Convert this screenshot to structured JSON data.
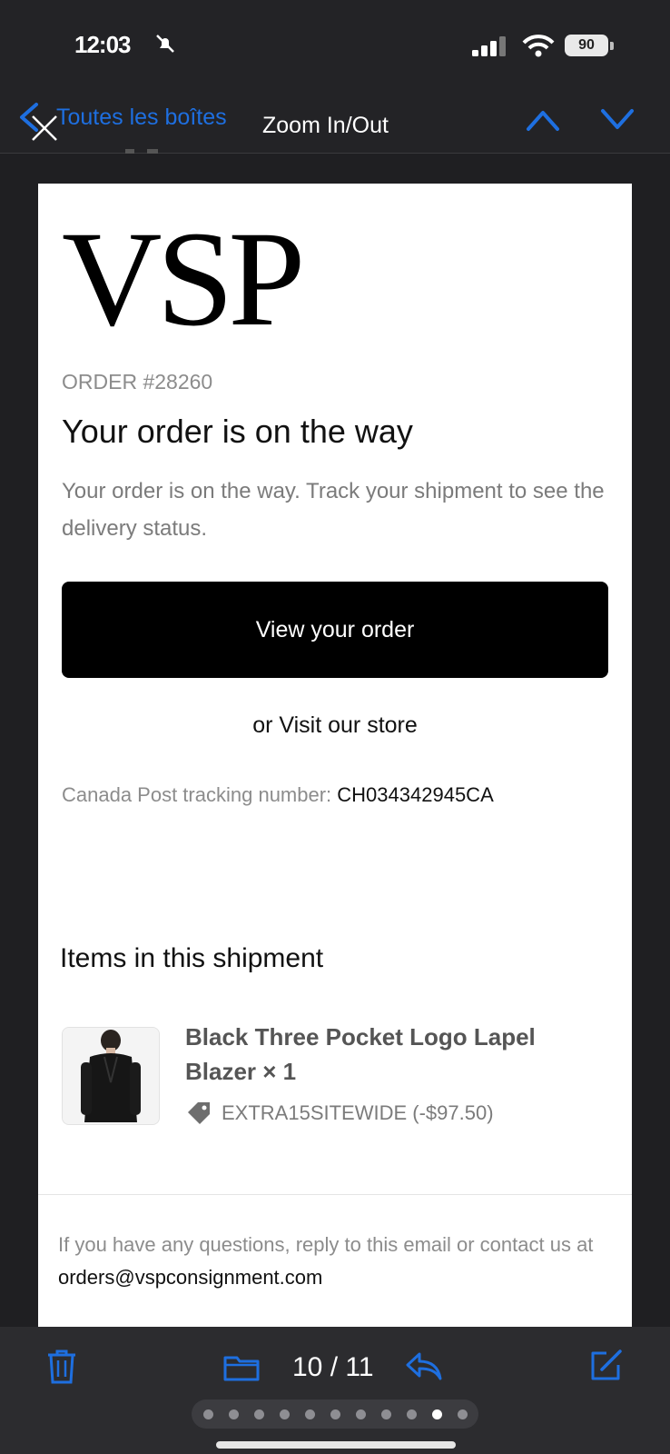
{
  "status_bar": {
    "time": "12:03",
    "battery": "90"
  },
  "nav": {
    "back_label": "Toutes les boîtes",
    "title": "Zoom In/Out"
  },
  "email": {
    "logo": "VSP",
    "order_number": "ORDER #28260",
    "headline": "Your order is on the way",
    "subtext": "Your order is on the way. Track your shipment to see the delivery status.",
    "view_order_button": "View your order",
    "visit_prefix": "or ",
    "visit_link": "Visit our store",
    "tracking_label": "Canada Post tracking number: ",
    "tracking_number": "CH034342945CA",
    "items_title": "Items in this shipment",
    "item": {
      "name": "Black Three Pocket Logo Lapel Blazer × 1",
      "discount": "EXTRA15SITEWIDE (-$97.50)"
    },
    "footer_text": "If you have any questions, reply to this email or contact us at ",
    "footer_email": "orders@vspconsignment.com"
  },
  "toolbar": {
    "page_counter": "10 / 11",
    "page_dots_total": 11,
    "page_dots_active": 10
  },
  "colors": {
    "accent": "#1e6fe0",
    "chrome": "#232326",
    "button": "#000000"
  },
  "icons": [
    "bell-slash-icon",
    "signal-icon",
    "wifi-icon",
    "battery-icon",
    "chevron-left-icon",
    "close-icon",
    "chevron-up-icon",
    "chevron-down-icon",
    "tag-icon",
    "trash-icon",
    "folder-icon",
    "reply-icon",
    "compose-icon"
  ]
}
